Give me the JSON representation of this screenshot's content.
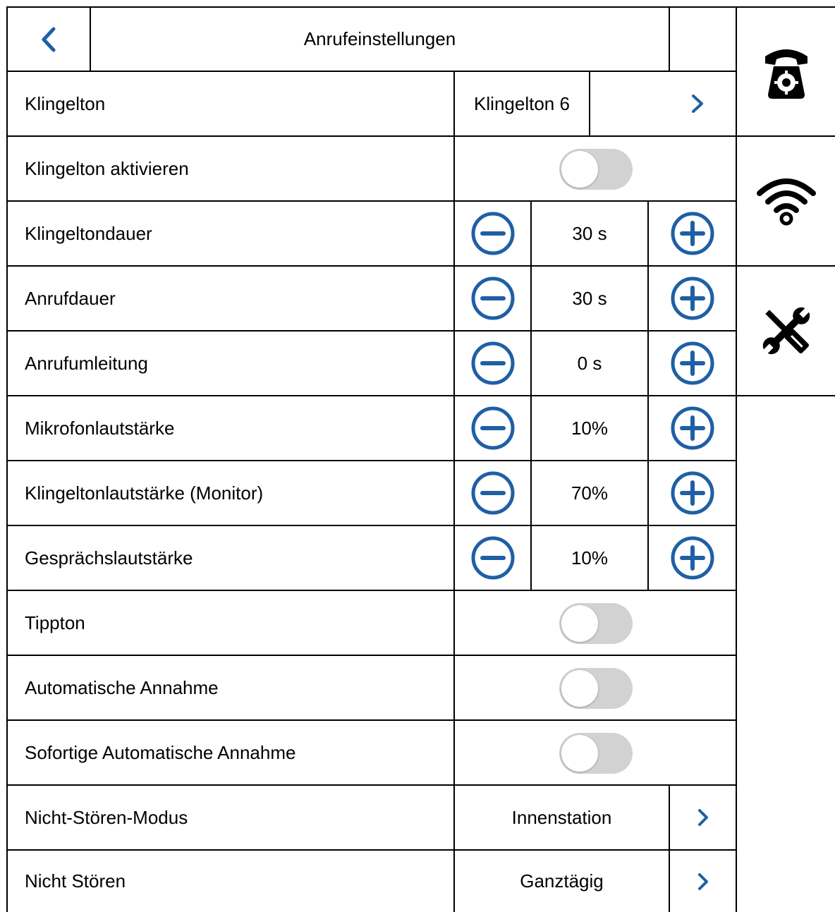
{
  "header": {
    "title": "Anrufeinstellungen"
  },
  "icons": {
    "back": "chevron-left-icon",
    "side": [
      "phone-settings-icon",
      "wifi-icon",
      "tools-icon"
    ]
  },
  "colors": {
    "accent": "#1f5fa5",
    "toggle_off": "#d2d2d2"
  },
  "rows": {
    "klingelton": {
      "label": "Klingelton",
      "value": "Klingelton 6"
    },
    "klingelton_aktivieren": {
      "label": "Klingelton aktivieren",
      "on": false
    },
    "klingeltondauer": {
      "label": "Klingeltondauer",
      "value": "30 s"
    },
    "anrufdauer": {
      "label": "Anrufdauer",
      "value": "30 s"
    },
    "anrufumleitung": {
      "label": "Anrufumleitung",
      "value": "0 s"
    },
    "mikrofonlautstaerke": {
      "label": "Mikrofonlautstärke",
      "value": "10%"
    },
    "klingeltonlautstaerke": {
      "label": "Klingeltonlautstärke (Monitor)",
      "value": "70%"
    },
    "gespraechslautstaerke": {
      "label": "Gesprächslautstärke",
      "value": "10%"
    },
    "tippton": {
      "label": "Tippton",
      "on": false
    },
    "automatische_annahme": {
      "label": "Automatische Annahme",
      "on": false
    },
    "sofortige_annahme": {
      "label": "Sofortige Automatische Annahme",
      "on": false
    },
    "nicht_stoeren_modus": {
      "label": "Nicht-Stören-Modus",
      "value": "Innenstation"
    },
    "nicht_stoeren": {
      "label": "Nicht Stören",
      "value": "Ganztägig"
    }
  }
}
